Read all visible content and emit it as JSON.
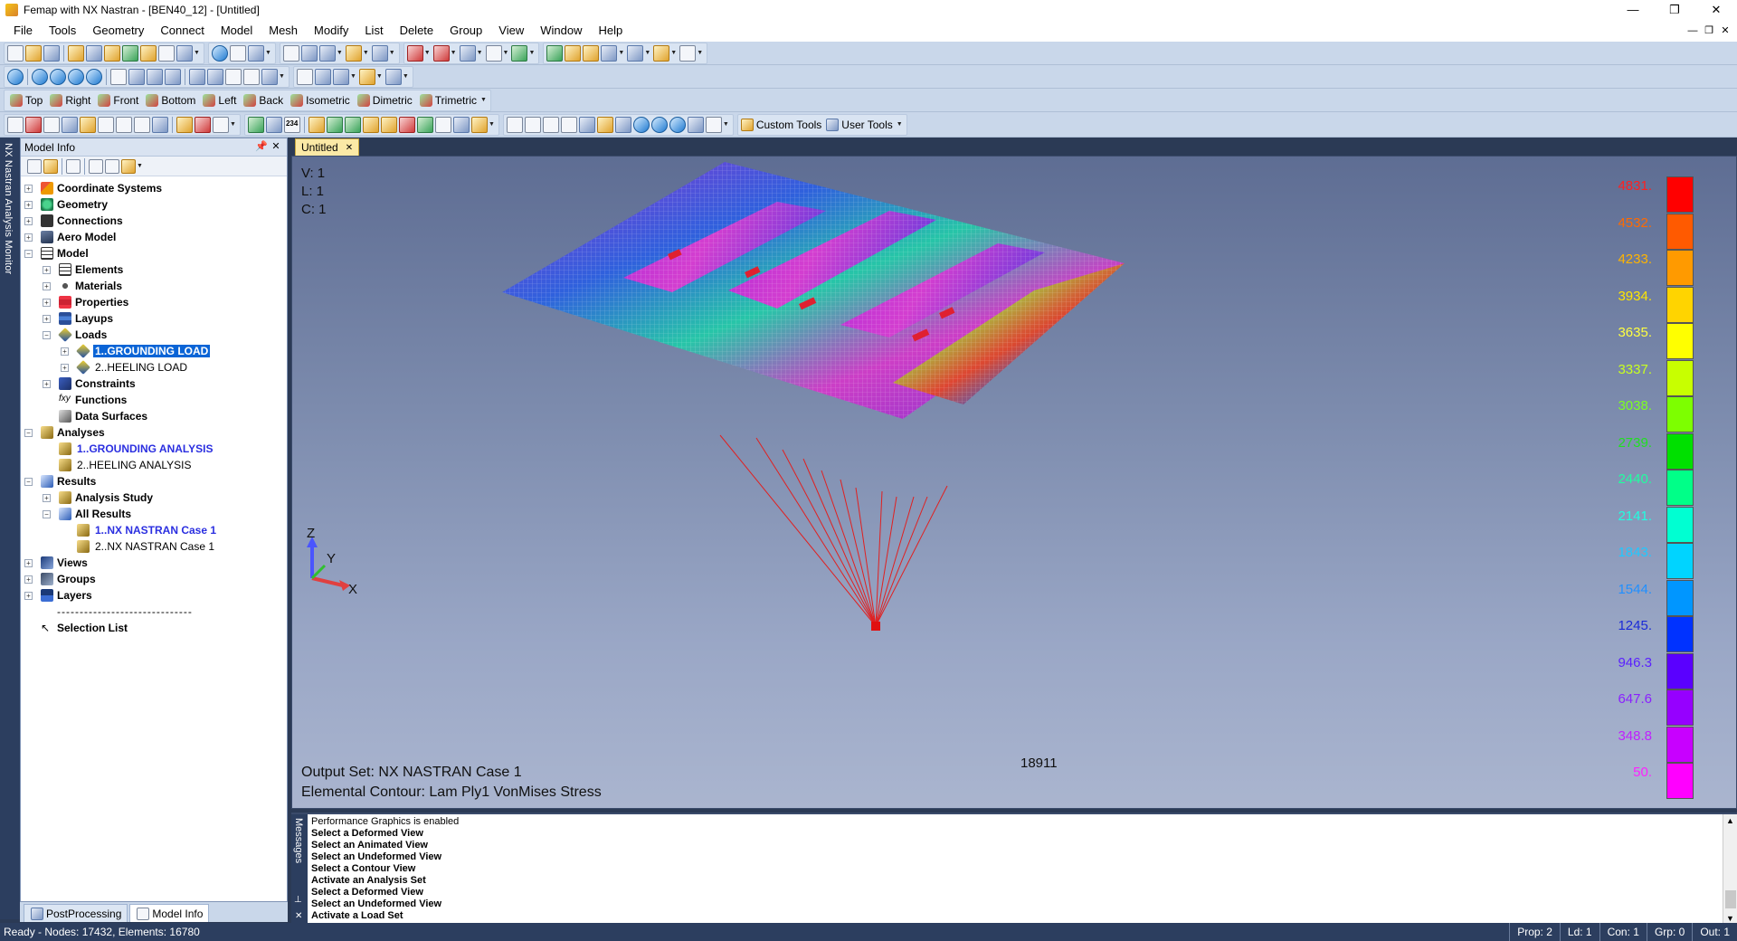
{
  "window": {
    "title": "Femap with NX Nastran - [BEN40_12] - [Untitled]",
    "controls": [
      "—",
      "❐",
      "✕"
    ]
  },
  "menubar": {
    "items": [
      "File",
      "Tools",
      "Geometry",
      "Connect",
      "Model",
      "Mesh",
      "Modify",
      "List",
      "Delete",
      "Group",
      "View",
      "Window",
      "Help"
    ],
    "mdi_controls": [
      "—",
      "❐",
      "✕"
    ]
  },
  "toolbars": {
    "view_buttons": [
      "Top",
      "Right",
      "Front",
      "Bottom",
      "Left",
      "Back",
      "Isometric",
      "Dimetric",
      "Trimetric"
    ],
    "custom_tools": "Custom Tools",
    "user_tools": "User Tools",
    "counter_icon": "234"
  },
  "side_strip": {
    "title": "NX Nastran Analysis Monitor"
  },
  "model_info": {
    "title": "Model Info",
    "tree": [
      {
        "label": "Coordinate Systems",
        "icon": "coord-icon"
      },
      {
        "label": "Geometry",
        "icon": "geometry-icon"
      },
      {
        "label": "Connections",
        "icon": "connections-icon"
      },
      {
        "label": "Aero Model",
        "icon": "aero-icon"
      },
      {
        "label": "Model",
        "icon": "model-icon"
      },
      {
        "label": "Elements",
        "icon": "elements-icon"
      },
      {
        "label": "Materials",
        "icon": "materials-icon"
      },
      {
        "label": "Properties",
        "icon": "properties-icon"
      },
      {
        "label": "Layups",
        "icon": "layups-icon"
      },
      {
        "label": "Loads",
        "icon": "loads-icon"
      },
      {
        "label": "1..GROUNDING LOAD",
        "icon": "load-set-icon"
      },
      {
        "label": "2..HEELING LOAD",
        "icon": "load-set-icon"
      },
      {
        "label": "Constraints",
        "icon": "constraints-icon"
      },
      {
        "label": "Functions",
        "icon": "functions-icon"
      },
      {
        "label": "Data Surfaces",
        "icon": "data-surfaces-icon"
      },
      {
        "label": "Analyses",
        "icon": "analyses-icon"
      },
      {
        "label": "1..GROUNDING ANALYSIS",
        "icon": "analysis-set-icon"
      },
      {
        "label": "2..HEELING ANALYSIS",
        "icon": "analysis-set-icon"
      },
      {
        "label": "Results",
        "icon": "results-icon"
      },
      {
        "label": "Analysis Study",
        "icon": "analysis-study-icon"
      },
      {
        "label": "All Results",
        "icon": "all-results-icon"
      },
      {
        "label": "1..NX NASTRAN Case 1",
        "icon": "output-set-icon"
      },
      {
        "label": "2..NX NASTRAN Case 1",
        "icon": "output-set-icon"
      },
      {
        "label": "Views",
        "icon": "views-icon"
      },
      {
        "label": "Groups",
        "icon": "groups-icon"
      },
      {
        "label": "Layers",
        "icon": "layers-icon"
      },
      {
        "label": "------------------------------",
        "icon": ""
      },
      {
        "label": "Selection List",
        "icon": "cursor-icon"
      }
    ]
  },
  "panel_tabs": [
    "PostProcessing",
    "Model Info"
  ],
  "document_tab": {
    "label": "Untitled",
    "close": "✕"
  },
  "viewport": {
    "v_label": "V: 1",
    "l_label": "L: 1",
    "c_label": "C: 1",
    "output_set": "Output Set: NX NASTRAN Case 1",
    "contour": "Elemental Contour: Lam Ply1 VonMises Stress",
    "node_label": "18911",
    "axes": {
      "z": "Z",
      "y": "Y",
      "x": "X"
    }
  },
  "legend": {
    "values": [
      "4831.",
      "4532.",
      "4233.",
      "3934.",
      "3635.",
      "3337.",
      "3038.",
      "2739.",
      "2440.",
      "2141.",
      "1843.",
      "1544.",
      "1245.",
      "946.3",
      "647.6",
      "348.8",
      "50."
    ],
    "colors": [
      "#ff0000",
      "#ff5a00",
      "#ff9a00",
      "#ffd400",
      "#ffff00",
      "#c8ff00",
      "#7dff00",
      "#00e000",
      "#00ff88",
      "#00ffd2",
      "#00d4ff",
      "#0096ff",
      "#0032ff",
      "#5a00ff",
      "#9600ff",
      "#c800ff",
      "#ff00ff"
    ],
    "value_colors": [
      "#ff2020",
      "#ff6a00",
      "#ffb400",
      "#ffe600",
      "#ffff40",
      "#c8ff20",
      "#7dff20",
      "#20e020",
      "#20ffa0",
      "#20ffe0",
      "#20c8ff",
      "#2090ff",
      "#1a2ad8",
      "#5a20ff",
      "#8a20ff",
      "#c020ff",
      "#ff20ff"
    ]
  },
  "messages": {
    "title": "Messages",
    "lines": [
      "Performance Graphics is enabled",
      "Select a Deformed View",
      "Select an Animated View",
      "Select an Undeformed View",
      "Select a Contour View",
      "Activate an Analysis Set",
      "Select a Deformed View",
      "Select an Undeformed View",
      "Activate a Load Set"
    ]
  },
  "statusbar": {
    "left": "Ready - Nodes: 17432,  Elements: 16780",
    "right": [
      "Prop: 2",
      "Ld: 1",
      "Con: 1",
      "Grp: 0",
      "Out: 1"
    ]
  }
}
